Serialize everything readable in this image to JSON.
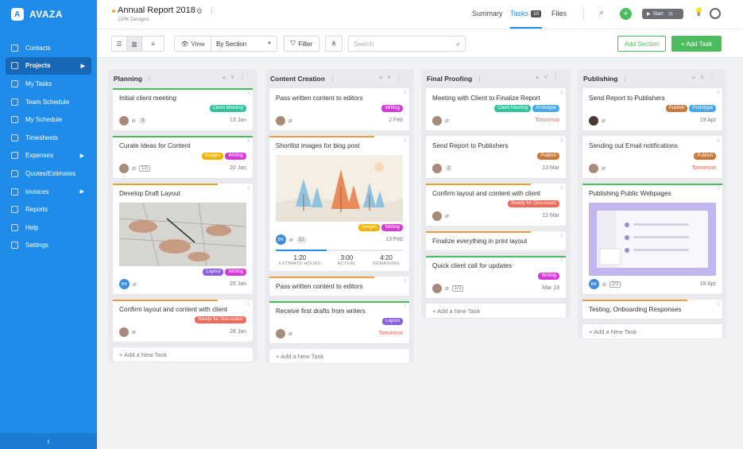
{
  "app": {
    "name": "AVAZA"
  },
  "sidebar": {
    "items": [
      {
        "label": "Contacts",
        "icon": "contacts-icon"
      },
      {
        "label": "Projects",
        "icon": "folder-icon"
      },
      {
        "label": "My Tasks",
        "icon": "tasks-icon"
      },
      {
        "label": "Team Schedule",
        "icon": "calendar-icon"
      },
      {
        "label": "My Schedule",
        "icon": "calendar-check-icon"
      },
      {
        "label": "Timesheets",
        "icon": "clock-icon"
      },
      {
        "label": "Expenses",
        "icon": "expenses-icon"
      },
      {
        "label": "Quotes/Estimates",
        "icon": "quote-icon"
      },
      {
        "label": "Invoices",
        "icon": "invoice-icon"
      },
      {
        "label": "Reports",
        "icon": "chart-icon"
      },
      {
        "label": "Help",
        "icon": "help-icon"
      },
      {
        "label": "Settings",
        "icon": "gear-icon"
      }
    ],
    "collapse": "‹"
  },
  "header": {
    "project_title": "Annual Report 2018",
    "project_client": "DPK Designs",
    "tabs": {
      "summary": "Summary",
      "tasks": "Tasks",
      "tasks_count": "10",
      "files": "Files"
    },
    "start_label": "Start"
  },
  "toolbar": {
    "view_label": "View",
    "group_value": "By Section",
    "filter_label": "Filter",
    "search_placeholder": "Search",
    "add_section": "Add Section",
    "add_task": "+ Add Task"
  },
  "colors": {
    "accent": "#1e8ce8",
    "green": "#4cbb5d",
    "orange": "#e9a23b",
    "red": "#e8665a"
  },
  "tag_colors": {
    "Client Meeting": "#2ec4a0",
    "Images": "#f0b400",
    "Writing": "#d63ad6",
    "Layout": "#8a5fe0",
    "Ready for Discussion": "#ef6a5a",
    "Prototype": "#4aa8e8",
    "Publish": "#c9793a"
  },
  "columns": [
    {
      "name": "Planning",
      "add_task": "+ Add a New Task",
      "cards": [
        {
          "title": "Initial client meeting",
          "tags": [
            "Client Meeting"
          ],
          "date": "13 Jan",
          "count": "3",
          "topbar": "#4cbb5d"
        },
        {
          "title": "Curate Ideas for Content",
          "tags": [
            "Images",
            "Writing"
          ],
          "date": "20 Jan",
          "subtasks": "1/3",
          "topbar": "#4cbb5d"
        },
        {
          "title": "Develop Draft Layout",
          "tags": [
            "Layout",
            "Writing"
          ],
          "date": "26 Jan",
          "image": "hands-drawing",
          "bk": "BK",
          "topbar": "#e9a23b"
        },
        {
          "title": "Confirm layout and content with client",
          "tags": [
            "Ready for Discussion"
          ],
          "date": "28 Jan",
          "topbar": "#e9a23b"
        }
      ]
    },
    {
      "name": "Content Creation",
      "add_task": "+ Add a New Task",
      "cards": [
        {
          "title": "Pass written content to editors",
          "tags": [
            "Writing"
          ],
          "date": "2 Feb",
          "topbar": ""
        },
        {
          "title": "Shortlist images for blog post",
          "tags": [
            "Images",
            "Writing"
          ],
          "date": "13 Feb",
          "image": "winter-trees",
          "bk": "BK",
          "count": "12",
          "timer": {
            "estimate": "1:20",
            "estimate_label": "ESTIMATE HOURS",
            "actual": "3:00",
            "actual_label": "ACTUAL",
            "remaining": "4:20",
            "remaining_label": "REMAINING"
          },
          "topbar": "#e9a23b"
        },
        {
          "title": "Pass written content to editors",
          "tags": [],
          "date": "",
          "topbar": "#e9a23b"
        },
        {
          "title": "Receive first drafts from writers",
          "tags": [
            "Layout"
          ],
          "date": "Tomorrow",
          "date_red": true,
          "topbar": "#4cbb5d"
        }
      ]
    },
    {
      "name": "Final Proofing",
      "add_task": "+ Add a New Task",
      "cards": [
        {
          "title": "Meeting with Client to Finalize Report",
          "tags": [
            "Client Meeting",
            "Prototype"
          ],
          "date": "Tomorrow",
          "date_red": true,
          "topbar": ""
        },
        {
          "title": "Send Report to Publishers",
          "tags": [
            "Publish"
          ],
          "date": "13 Mar",
          "count": "2",
          "topbar": ""
        },
        {
          "title": "Confirm layout and content with client",
          "tags": [
            "Ready for Discussion"
          ],
          "date": "13 Mar",
          "topbar": "#e9a23b"
        },
        {
          "title": "Finalize everything in print layout",
          "tags": [],
          "date": "",
          "topbar": "#e9a23b"
        },
        {
          "title": "Quick client call for updates",
          "tags": [
            "Writing"
          ],
          "date": "Mar 19",
          "subtasks": "1/3",
          "topbar": "#4cbb5d"
        }
      ]
    },
    {
      "name": "Publishing",
      "add_task": "+ Add a New Task",
      "cards": [
        {
          "title": "Send Report to Publishers",
          "tags": [
            "Publish",
            "Prototype"
          ],
          "date": "19 Apr",
          "topbar": ""
        },
        {
          "title": "Sending out Email notifications",
          "tags": [
            "Publish"
          ],
          "date": "Tomorrow",
          "date_red": true,
          "topbar": ""
        },
        {
          "title": "Publishing Public Webpages",
          "tags": [],
          "date": "18 Apr",
          "image": "dashboard-mockup",
          "bk": "BK",
          "subtasks": "2/2",
          "topbar": "#4cbb5d"
        },
        {
          "title": "Testing, Onboarding Responses",
          "tags": [],
          "date": "",
          "topbar": "#e9a23b"
        }
      ]
    }
  ]
}
